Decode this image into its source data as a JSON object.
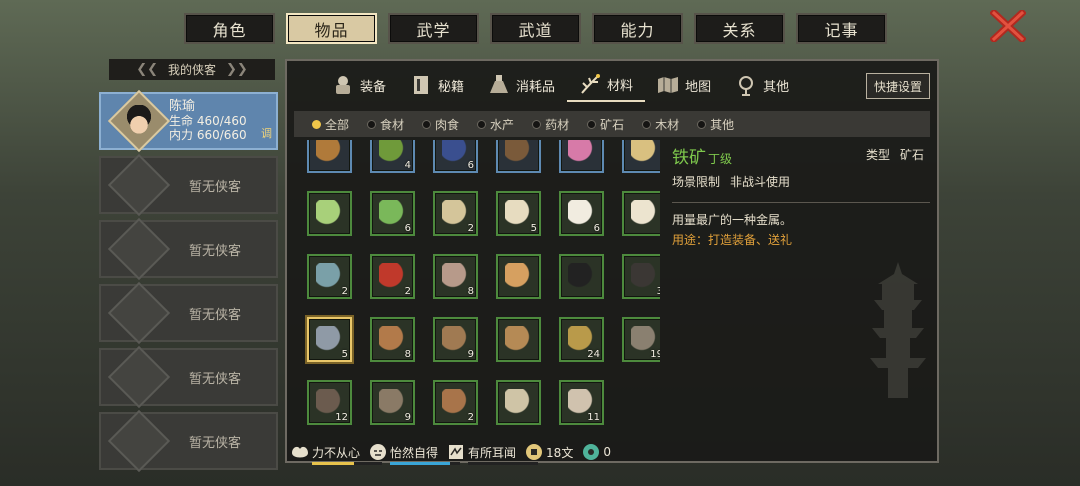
{
  "top_tabs": [
    {
      "label": "角色"
    },
    {
      "label": "物品",
      "active": true
    },
    {
      "label": "武学"
    },
    {
      "label": "武道"
    },
    {
      "label": "能力"
    },
    {
      "label": "关系"
    },
    {
      "label": "记事"
    }
  ],
  "left": {
    "header": "我的侠客",
    "hero": {
      "name": "陈瑜",
      "hp_label": "生命",
      "hp": "460/460",
      "mp_label": "内力",
      "mp": "660/660",
      "tag": "调"
    },
    "empty_slot_text": "暂无侠客"
  },
  "sub_tabs": [
    {
      "label": "装备",
      "icon": "armor-icon"
    },
    {
      "label": "秘籍",
      "icon": "book-icon"
    },
    {
      "label": "消耗品",
      "icon": "potion-icon"
    },
    {
      "label": "材料",
      "icon": "herb-icon",
      "active": true
    },
    {
      "label": "地图",
      "icon": "map-icon"
    },
    {
      "label": "其他",
      "icon": "misc-icon"
    }
  ],
  "quick_button": "快捷设置",
  "filters": [
    {
      "label": "全部",
      "on": true
    },
    {
      "label": "食材"
    },
    {
      "label": "肉食"
    },
    {
      "label": "水产"
    },
    {
      "label": "药材"
    },
    {
      "label": "矿石"
    },
    {
      "label": "木材"
    },
    {
      "label": "其他"
    }
  ],
  "items": [
    {
      "icon": "nuts-icon",
      "count": "",
      "frame": "blue"
    },
    {
      "icon": "zongzi-icon",
      "count": "4",
      "frame": "blue"
    },
    {
      "icon": "vase-icon",
      "count": "6",
      "frame": "blue"
    },
    {
      "icon": "twig-icon",
      "count": "",
      "frame": "blue"
    },
    {
      "icon": "lotus-icon",
      "count": "",
      "frame": "blue"
    },
    {
      "icon": "beans-icon",
      "count": "",
      "frame": "blue"
    },
    {
      "icon": "cabbage-icon",
      "count": "",
      "frame": "green"
    },
    {
      "icon": "bokchoy-icon",
      "count": "6",
      "frame": "green"
    },
    {
      "icon": "seeds-icon",
      "count": "2",
      "frame": "green"
    },
    {
      "icon": "eggs-icon",
      "count": "5",
      "frame": "green"
    },
    {
      "icon": "rice-icon",
      "count": "6",
      "frame": "green"
    },
    {
      "icon": "flour-icon",
      "count": "",
      "frame": "green"
    },
    {
      "icon": "mirror-icon",
      "count": "2",
      "frame": "green"
    },
    {
      "icon": "chili-icon",
      "count": "2",
      "frame": "green"
    },
    {
      "icon": "worm-icon",
      "count": "8",
      "frame": "green"
    },
    {
      "icon": "grain-icon",
      "count": "",
      "frame": "green"
    },
    {
      "icon": "spider-icon",
      "count": "",
      "frame": "green"
    },
    {
      "icon": "coal-icon",
      "count": "3",
      "frame": "green"
    },
    {
      "icon": "iron-ore-icon",
      "count": "5",
      "frame": "green",
      "selected": true
    },
    {
      "icon": "copper-ore-icon",
      "count": "8",
      "frame": "green"
    },
    {
      "icon": "branch-icon",
      "count": "9",
      "frame": "green"
    },
    {
      "icon": "logs-icon",
      "count": "",
      "frame": "green"
    },
    {
      "icon": "leaves-icon",
      "count": "24",
      "frame": "green"
    },
    {
      "icon": "bark-icon",
      "count": "19",
      "frame": "green"
    },
    {
      "icon": "hide-icon",
      "count": "12",
      "frame": "green"
    },
    {
      "icon": "rope-icon",
      "count": "9",
      "frame": "green"
    },
    {
      "icon": "pelt-icon",
      "count": "2",
      "frame": "green"
    },
    {
      "icon": "cloth-icon",
      "count": "",
      "frame": "green"
    },
    {
      "icon": "fur-icon",
      "count": "11",
      "frame": "green"
    }
  ],
  "detail": {
    "name": "铁矿",
    "grade": "丁级",
    "type_label": "类型",
    "type_value": "矿石",
    "scene_label": "场景限制",
    "scene_value": "非战斗使用",
    "desc": "用量最广的一种金属。",
    "use": "用途：打造装备、送礼"
  },
  "status": [
    {
      "label": "力不从心",
      "icon": "muscle-icon",
      "level": 0.6,
      "color": "#e8c34c"
    },
    {
      "label": "怡然自得",
      "icon": "mood-icon",
      "level": 0.85,
      "color": "#3aa6d8"
    },
    {
      "label": "有所耳闻",
      "icon": "scroll-icon",
      "level": 0
    },
    {
      "label": "18文",
      "icon": "coin-icon"
    },
    {
      "label": "0",
      "icon": "jade-icon"
    }
  ]
}
